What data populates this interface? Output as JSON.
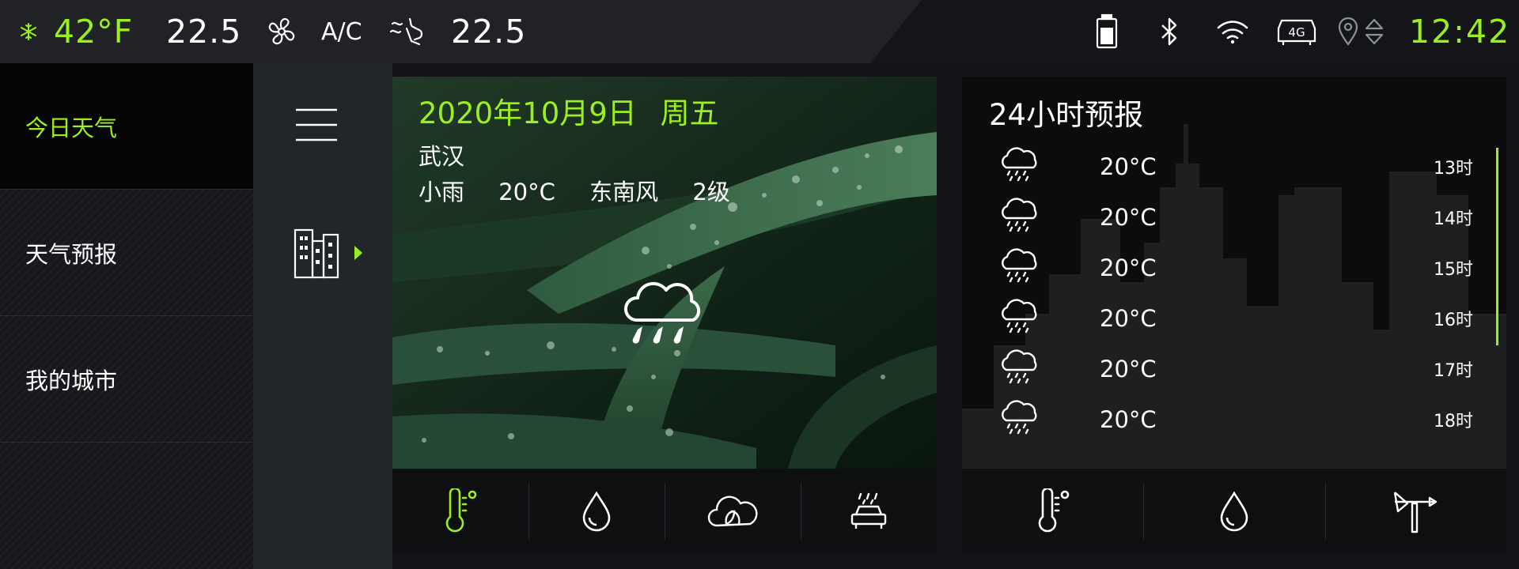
{
  "status_bar": {
    "outside_temp": "42°F",
    "left_setpoint": "22.5",
    "ac_label": "A/C",
    "right_setpoint": "22.5",
    "network_label": "4G",
    "clock": "12:42",
    "icons": [
      "snowflake-icon",
      "fan-icon",
      "seat-airflow-icon",
      "battery-icon",
      "bluetooth-icon",
      "wifi-icon",
      "4g-icon",
      "location-icon",
      "sort-arrows-icon"
    ]
  },
  "menu": {
    "items": [
      {
        "label": "今日天气",
        "active": true
      },
      {
        "label": "天气预报",
        "active": false
      },
      {
        "label": "我的城市",
        "active": false
      }
    ]
  },
  "side_strip": {
    "icons": [
      "hamburger-icon",
      "city-buildings-icon",
      "arrow-right-icon"
    ]
  },
  "today": {
    "date": "2020年10月9日",
    "weekday": "周五",
    "city": "武汉",
    "condition": "小雨",
    "temperature": "20°C",
    "wind_direction": "东南风",
    "wind_level": "2级",
    "icon": "light-rain-cloud-icon",
    "bottom_icons": [
      "thermometer-icon",
      "humidity-drop-icon",
      "air-quality-cloud-icon",
      "car-wash-icon"
    ]
  },
  "forecast": {
    "title": "24小时预报",
    "rows": [
      {
        "temp": "20°C",
        "hour": "13时"
      },
      {
        "temp": "20°C",
        "hour": "14时"
      },
      {
        "temp": "20°C",
        "hour": "15时"
      },
      {
        "temp": "20°C",
        "hour": "16时"
      },
      {
        "temp": "20°C",
        "hour": "17时"
      },
      {
        "temp": "20°C",
        "hour": "18时"
      }
    ],
    "bottom_icons": [
      "thermometer-icon",
      "humidity-drop-icon",
      "wind-vane-icon"
    ]
  },
  "colors": {
    "accent": "#9bef1e",
    "background": "#131417",
    "panel": "#0c0c0d"
  }
}
